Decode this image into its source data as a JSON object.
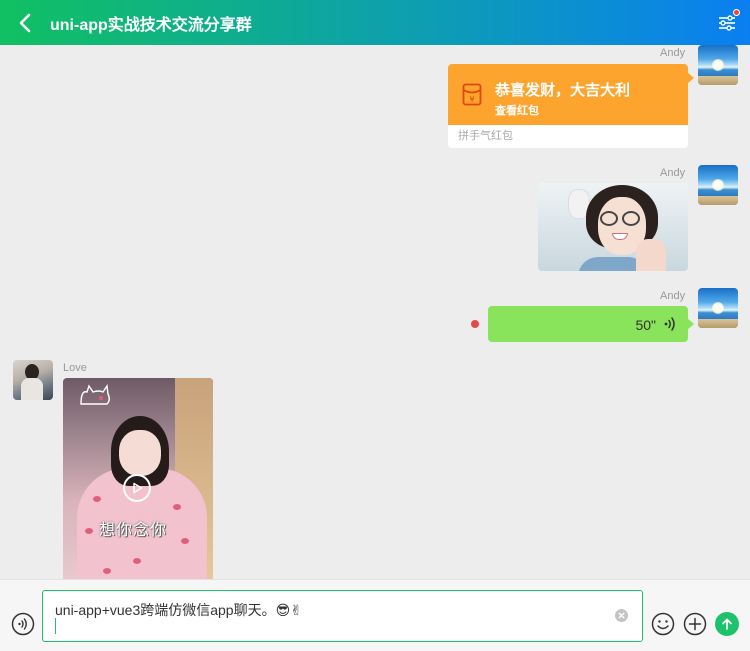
{
  "header": {
    "title": "uni-app实战技术交流分享群",
    "back_icon": "chevron-left-icon",
    "menu_icon": "sliders-icon",
    "badge_color": "#f0453a"
  },
  "messages": [
    {
      "type": "red-packet",
      "side": "right",
      "nick": "Andy",
      "title": "恭喜发财，大吉大利",
      "action": "查看红包",
      "footer": "拼手气红包",
      "color": "#fda42f"
    },
    {
      "type": "image",
      "side": "right",
      "nick": "Andy"
    },
    {
      "type": "voice",
      "side": "right",
      "nick": "Andy",
      "duration": "50\"",
      "color": "#89e35b",
      "unread": true
    },
    {
      "type": "video",
      "side": "left",
      "nick": "Love",
      "caption": "想你念你"
    }
  ],
  "footer": {
    "input_value": "uni-app+vue3跨端仿微信app聊天。😎✌",
    "accent": "#1cc36b",
    "voice_icon": "voice-input-icon",
    "emoji_icon": "emoji-icon",
    "plus_icon": "plus-icon",
    "send_icon": "send-arrow-icon"
  }
}
